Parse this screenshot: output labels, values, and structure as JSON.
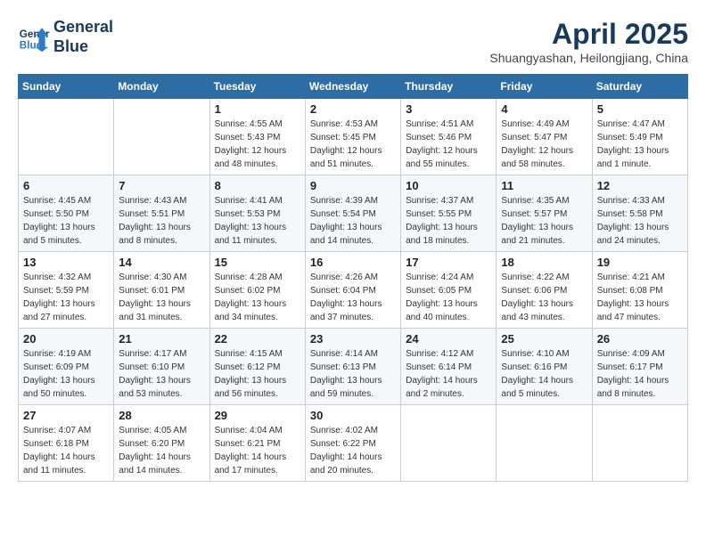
{
  "header": {
    "logo_line1": "General",
    "logo_line2": "Blue",
    "month_year": "April 2025",
    "location": "Shuangyashan, Heilongjiang, China"
  },
  "weekdays": [
    "Sunday",
    "Monday",
    "Tuesday",
    "Wednesday",
    "Thursday",
    "Friday",
    "Saturday"
  ],
  "weeks": [
    [
      {
        "day": "",
        "info": ""
      },
      {
        "day": "",
        "info": ""
      },
      {
        "day": "1",
        "info": "Sunrise: 4:55 AM\nSunset: 5:43 PM\nDaylight: 12 hours\nand 48 minutes."
      },
      {
        "day": "2",
        "info": "Sunrise: 4:53 AM\nSunset: 5:45 PM\nDaylight: 12 hours\nand 51 minutes."
      },
      {
        "day": "3",
        "info": "Sunrise: 4:51 AM\nSunset: 5:46 PM\nDaylight: 12 hours\nand 55 minutes."
      },
      {
        "day": "4",
        "info": "Sunrise: 4:49 AM\nSunset: 5:47 PM\nDaylight: 12 hours\nand 58 minutes."
      },
      {
        "day": "5",
        "info": "Sunrise: 4:47 AM\nSunset: 5:49 PM\nDaylight: 13 hours\nand 1 minute."
      }
    ],
    [
      {
        "day": "6",
        "info": "Sunrise: 4:45 AM\nSunset: 5:50 PM\nDaylight: 13 hours\nand 5 minutes."
      },
      {
        "day": "7",
        "info": "Sunrise: 4:43 AM\nSunset: 5:51 PM\nDaylight: 13 hours\nand 8 minutes."
      },
      {
        "day": "8",
        "info": "Sunrise: 4:41 AM\nSunset: 5:53 PM\nDaylight: 13 hours\nand 11 minutes."
      },
      {
        "day": "9",
        "info": "Sunrise: 4:39 AM\nSunset: 5:54 PM\nDaylight: 13 hours\nand 14 minutes."
      },
      {
        "day": "10",
        "info": "Sunrise: 4:37 AM\nSunset: 5:55 PM\nDaylight: 13 hours\nand 18 minutes."
      },
      {
        "day": "11",
        "info": "Sunrise: 4:35 AM\nSunset: 5:57 PM\nDaylight: 13 hours\nand 21 minutes."
      },
      {
        "day": "12",
        "info": "Sunrise: 4:33 AM\nSunset: 5:58 PM\nDaylight: 13 hours\nand 24 minutes."
      }
    ],
    [
      {
        "day": "13",
        "info": "Sunrise: 4:32 AM\nSunset: 5:59 PM\nDaylight: 13 hours\nand 27 minutes."
      },
      {
        "day": "14",
        "info": "Sunrise: 4:30 AM\nSunset: 6:01 PM\nDaylight: 13 hours\nand 31 minutes."
      },
      {
        "day": "15",
        "info": "Sunrise: 4:28 AM\nSunset: 6:02 PM\nDaylight: 13 hours\nand 34 minutes."
      },
      {
        "day": "16",
        "info": "Sunrise: 4:26 AM\nSunset: 6:04 PM\nDaylight: 13 hours\nand 37 minutes."
      },
      {
        "day": "17",
        "info": "Sunrise: 4:24 AM\nSunset: 6:05 PM\nDaylight: 13 hours\nand 40 minutes."
      },
      {
        "day": "18",
        "info": "Sunrise: 4:22 AM\nSunset: 6:06 PM\nDaylight: 13 hours\nand 43 minutes."
      },
      {
        "day": "19",
        "info": "Sunrise: 4:21 AM\nSunset: 6:08 PM\nDaylight: 13 hours\nand 47 minutes."
      }
    ],
    [
      {
        "day": "20",
        "info": "Sunrise: 4:19 AM\nSunset: 6:09 PM\nDaylight: 13 hours\nand 50 minutes."
      },
      {
        "day": "21",
        "info": "Sunrise: 4:17 AM\nSunset: 6:10 PM\nDaylight: 13 hours\nand 53 minutes."
      },
      {
        "day": "22",
        "info": "Sunrise: 4:15 AM\nSunset: 6:12 PM\nDaylight: 13 hours\nand 56 minutes."
      },
      {
        "day": "23",
        "info": "Sunrise: 4:14 AM\nSunset: 6:13 PM\nDaylight: 13 hours\nand 59 minutes."
      },
      {
        "day": "24",
        "info": "Sunrise: 4:12 AM\nSunset: 6:14 PM\nDaylight: 14 hours\nand 2 minutes."
      },
      {
        "day": "25",
        "info": "Sunrise: 4:10 AM\nSunset: 6:16 PM\nDaylight: 14 hours\nand 5 minutes."
      },
      {
        "day": "26",
        "info": "Sunrise: 4:09 AM\nSunset: 6:17 PM\nDaylight: 14 hours\nand 8 minutes."
      }
    ],
    [
      {
        "day": "27",
        "info": "Sunrise: 4:07 AM\nSunset: 6:18 PM\nDaylight: 14 hours\nand 11 minutes."
      },
      {
        "day": "28",
        "info": "Sunrise: 4:05 AM\nSunset: 6:20 PM\nDaylight: 14 hours\nand 14 minutes."
      },
      {
        "day": "29",
        "info": "Sunrise: 4:04 AM\nSunset: 6:21 PM\nDaylight: 14 hours\nand 17 minutes."
      },
      {
        "day": "30",
        "info": "Sunrise: 4:02 AM\nSunset: 6:22 PM\nDaylight: 14 hours\nand 20 minutes."
      },
      {
        "day": "",
        "info": ""
      },
      {
        "day": "",
        "info": ""
      },
      {
        "day": "",
        "info": ""
      }
    ]
  ]
}
